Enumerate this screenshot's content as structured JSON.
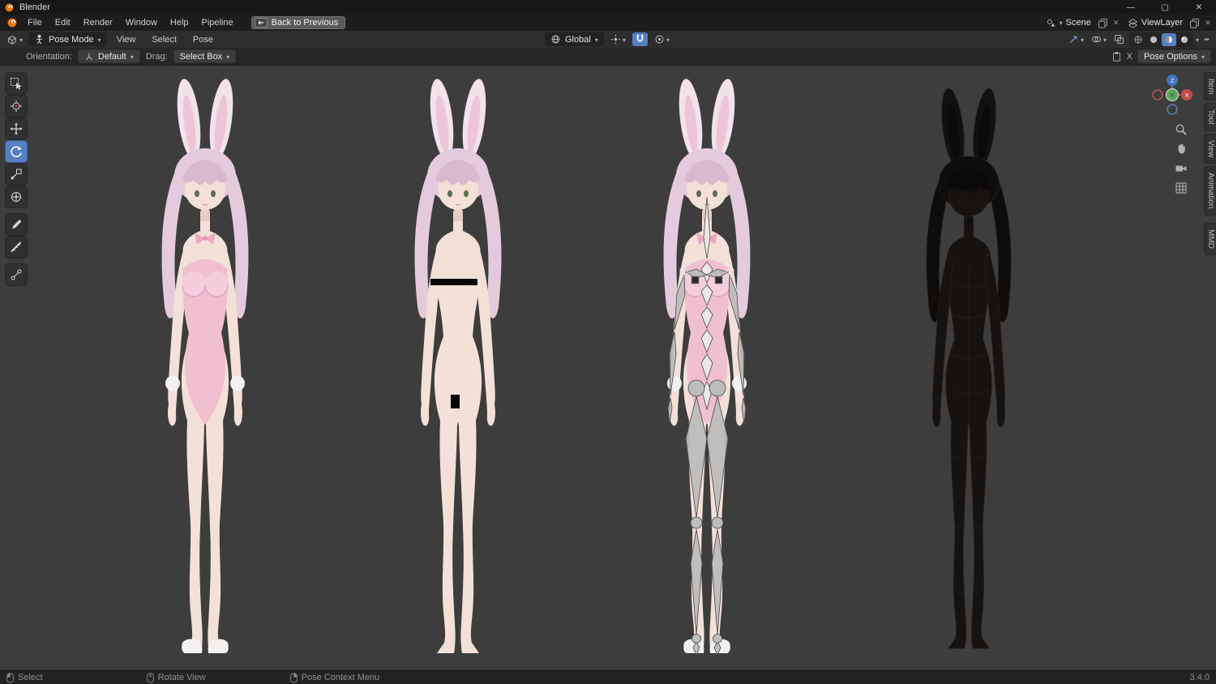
{
  "titlebar": {
    "app_title": "Blender",
    "window_controls": {
      "minimize": "—",
      "maximize": "▢",
      "close": "✕"
    }
  },
  "menubar": {
    "menus": [
      {
        "label": "File"
      },
      {
        "label": "Edit"
      },
      {
        "label": "Render"
      },
      {
        "label": "Window"
      },
      {
        "label": "Help"
      },
      {
        "label": "Pipeline"
      }
    ],
    "back_button": "Back to Previous",
    "scene_selector": {
      "value": "Scene"
    },
    "viewlayer_selector": {
      "value": "ViewLayer"
    }
  },
  "viewport_header": {
    "mode": "Pose Mode",
    "menus": [
      {
        "label": "View"
      },
      {
        "label": "Select"
      },
      {
        "label": "Pose"
      }
    ],
    "orientation": "Global"
  },
  "tool_settings": {
    "orientation_label": "Orientation:",
    "orientation_value": "Default",
    "drag_label": "Drag:",
    "drag_value": "Select Box",
    "clipboard_x": "X",
    "pose_options": "Pose Options"
  },
  "sidebar_tabs": [
    {
      "label": "Item"
    },
    {
      "label": "Tool"
    },
    {
      "label": "View"
    },
    {
      "label": "Animation"
    },
    {
      "label": "MMD"
    }
  ],
  "nav_gizmo": {
    "x": "X",
    "y": "Y",
    "z": "Z"
  },
  "statusbar": {
    "hints": [
      {
        "label": "Select"
      },
      {
        "label": "Rotate View"
      },
      {
        "label": "Pose Context Menu"
      }
    ],
    "version": "3.4.0"
  },
  "scene_content": {
    "figures": [
      {
        "name": "model-bunny-suit"
      },
      {
        "name": "model-body-censored"
      },
      {
        "name": "model-armature-overlay"
      },
      {
        "name": "model-wireframe"
      }
    ]
  },
  "colors": {
    "accent_blue": "#5680c2",
    "viewport_bg": "#3d3d3d",
    "suit_pink": "#f1bfd2",
    "hair_pink": "#e4cbdb"
  }
}
